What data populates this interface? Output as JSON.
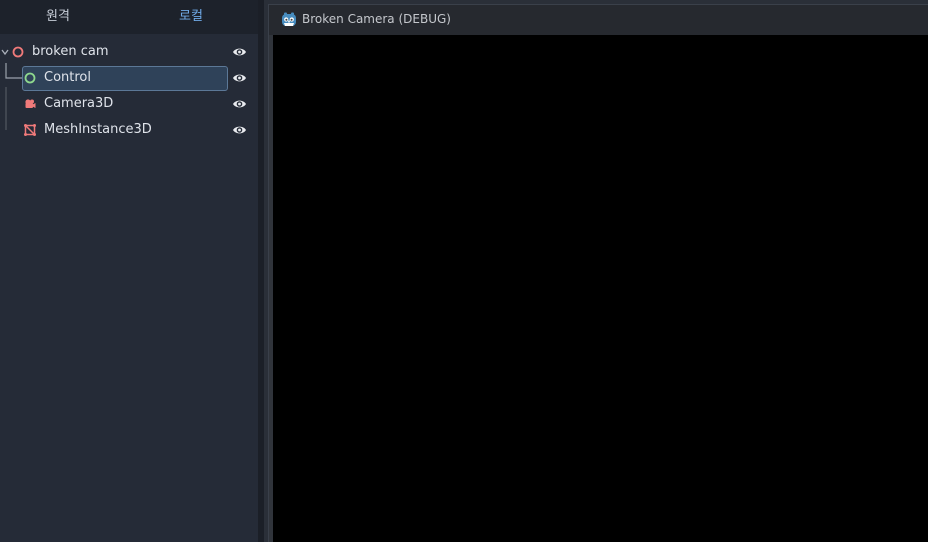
{
  "scene_dock": {
    "tabs": [
      {
        "label": "원격",
        "active": false
      },
      {
        "label": "로컬",
        "active": true
      }
    ],
    "tree": [
      {
        "label": "broken cam",
        "icon": "node-circle-icon",
        "icon_color": "#f07a7a",
        "depth": 0,
        "expanded": true,
        "visible": true
      },
      {
        "label": "Control",
        "icon": "control-circle-icon",
        "icon_color": "#8ed88e",
        "depth": 1,
        "selected": true,
        "visible": true
      },
      {
        "label": "Camera3D",
        "icon": "camera3d-icon",
        "icon_color": "#f07a7a",
        "depth": 1,
        "visible": true
      },
      {
        "label": "MeshInstance3D",
        "icon": "mesh-instance-icon",
        "icon_color": "#f07a7a",
        "depth": 1,
        "visible": true
      }
    ]
  },
  "game_window": {
    "title": "Broken Camera (DEBUG)",
    "app_icon": "godot-icon",
    "viewport_color": "#000000"
  },
  "colors": {
    "accent": "#6fa9e6",
    "node3d": "#f07a7a",
    "control": "#8ed88e",
    "selection": "#2f4259"
  }
}
